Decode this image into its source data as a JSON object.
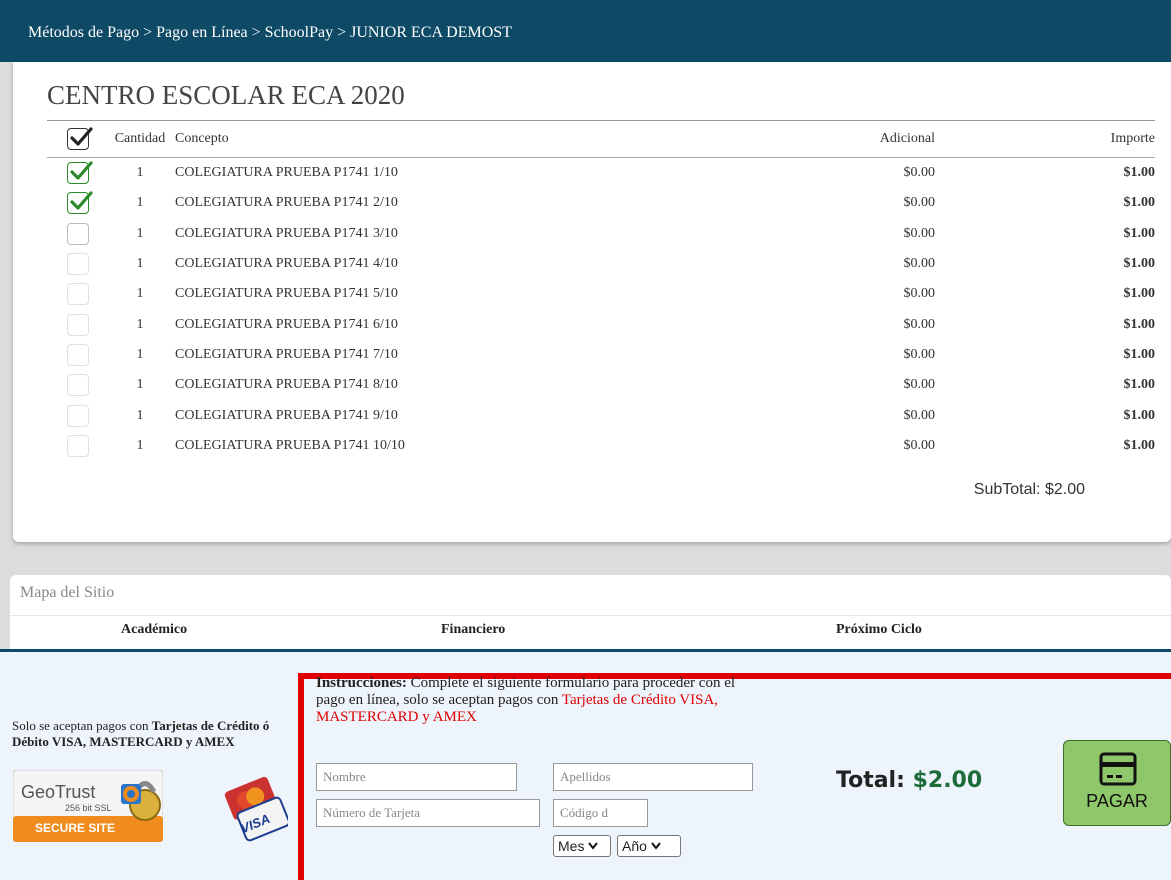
{
  "breadcrumb": "Métodos de Pago > Pago en Línea > SchoolPay > JUNIOR ECA DEMOST",
  "school_title": "CENTRO ESCOLAR ECA 2020",
  "table": {
    "headers": {
      "qty": "Cantidad",
      "concept": "Concepto",
      "additional": "Adicional",
      "amount": "Importe"
    },
    "rows": [
      {
        "checked": "checked",
        "qty": "1",
        "concept": "COLEGIATURA PRUEBA P1741 1/10",
        "additional": "$0.00",
        "amount": "$1.00"
      },
      {
        "checked": "checked",
        "qty": "1",
        "concept": "COLEGIATURA PRUEBA P1741 2/10",
        "additional": "$0.00",
        "amount": "$1.00"
      },
      {
        "checked": "enabled",
        "qty": "1",
        "concept": "COLEGIATURA PRUEBA P1741 3/10",
        "additional": "$0.00",
        "amount": "$1.00"
      },
      {
        "checked": "disabled",
        "qty": "1",
        "concept": "COLEGIATURA PRUEBA P1741 4/10",
        "additional": "$0.00",
        "amount": "$1.00"
      },
      {
        "checked": "disabled",
        "qty": "1",
        "concept": "COLEGIATURA PRUEBA P1741 5/10",
        "additional": "$0.00",
        "amount": "$1.00"
      },
      {
        "checked": "disabled",
        "qty": "1",
        "concept": "COLEGIATURA PRUEBA P1741 6/10",
        "additional": "$0.00",
        "amount": "$1.00"
      },
      {
        "checked": "disabled",
        "qty": "1",
        "concept": "COLEGIATURA PRUEBA P1741 7/10",
        "additional": "$0.00",
        "amount": "$1.00"
      },
      {
        "checked": "disabled",
        "qty": "1",
        "concept": "COLEGIATURA PRUEBA P1741 8/10",
        "additional": "$0.00",
        "amount": "$1.00"
      },
      {
        "checked": "disabled",
        "qty": "1",
        "concept": "COLEGIATURA PRUEBA P1741 9/10",
        "additional": "$0.00",
        "amount": "$1.00"
      },
      {
        "checked": "disabled",
        "qty": "1",
        "concept": "COLEGIATURA PRUEBA P1741 10/10",
        "additional": "$0.00",
        "amount": "$1.00"
      }
    ],
    "subtotal_label": "SubTotal:",
    "subtotal_value": "$2.00"
  },
  "sitemap": {
    "title": "Mapa del Sitio",
    "columns": [
      "Académico",
      "Financiero",
      "Próximo Ciclo"
    ]
  },
  "payment": {
    "left_text_1": "Solo se aceptan pagos con ",
    "left_text_bold": "Tarjetas de Crédito ó Débito VISA, MASTERCARD y AMEX",
    "instructions_label": "Instrucciones:",
    "instructions_text": " Complete el siguiente formulario para proceder con el pago en línea, solo se aceptan pagos con ",
    "instructions_red": "Tarjetas de Crédito VISA, MASTERCARD y AMEX",
    "first_name_placeholder": "Nombre",
    "last_name_placeholder": "Apellidos",
    "card_number_placeholder": "Número de Tarjeta",
    "cvv_placeholder": "Código d",
    "month_label": "Mes",
    "year_label": "Año",
    "total_label": "Total:",
    "total_value": "$2.00",
    "pay_button": "PAGAR"
  },
  "badges": {
    "geotrust_brand": "GeoTrust",
    "geotrust_ssl": "256 bit SSL",
    "geotrust_secure": "SECURE SITE",
    "cards_brand": "VISA"
  },
  "colors": {
    "header_bg": "#0e4a66",
    "check_green": "#2a8a2a",
    "alert_red": "#e00000",
    "total_green": "#1e6b3a",
    "pay_button_bg": "#8fc86a"
  }
}
